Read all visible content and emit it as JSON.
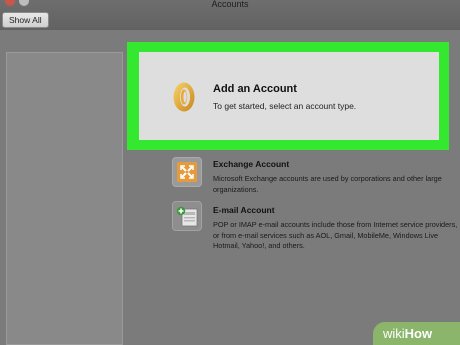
{
  "window": {
    "title": "Accounts",
    "show_all_label": "Show All"
  },
  "add_account": {
    "title": "Add an Account",
    "subtitle": "To get started, select an account type.",
    "icon": "outlook-icon",
    "highlight_color": "#34e82f"
  },
  "account_types": [
    {
      "title": "Exchange Account",
      "description": "Microsoft Exchange accounts are used by corporations and other large organizations.",
      "icon": "exchange-icon"
    },
    {
      "title": "E-mail Account",
      "description": "POP or IMAP e-mail accounts include those from Internet service providers, or from e-mail services such as AOL, Gmail, MobileMe, Windows Live Hotmail, Yahoo!, and others.",
      "icon": "email-icon"
    }
  ],
  "watermark": {
    "part1": "wiki",
    "part2": "How"
  }
}
